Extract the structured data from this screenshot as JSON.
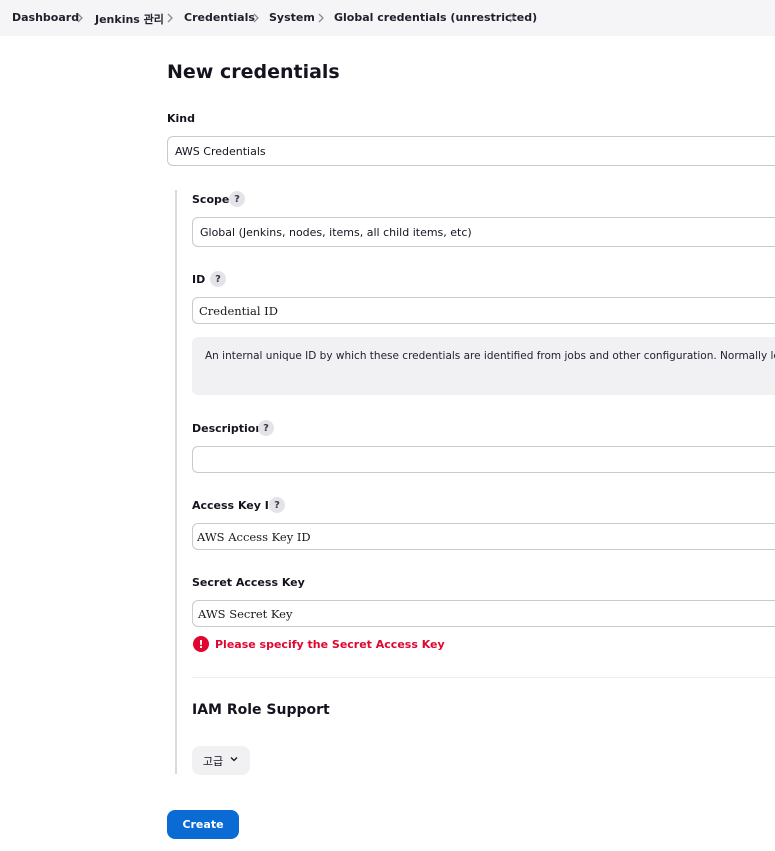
{
  "breadcrumb": {
    "items": [
      "Dashboard",
      "Jenkins 관리",
      "Credentials",
      "System",
      "Global credentials (unrestricted)"
    ],
    "separator_icon": "chevron-right-icon"
  },
  "page": {
    "title": "New credentials"
  },
  "form": {
    "kind": {
      "label": "Kind",
      "value": "AWS Credentials"
    },
    "scope": {
      "label": "Scope",
      "help": "?",
      "value": "Global (Jenkins, nodes, items, all child items, etc)"
    },
    "id": {
      "label": "ID",
      "help": "?",
      "value": "Credential ID",
      "help_text": "An internal unique ID by which these credentials are identified from jobs and other configuration. Normally left b"
    },
    "description": {
      "label": "Description",
      "help": "?",
      "value": ""
    },
    "access_key_id": {
      "label": "Access Key ID",
      "help": "?",
      "value": "AWS Access Key ID"
    },
    "secret_access_key": {
      "label": "Secret Access Key",
      "value": "AWS Secret Key",
      "error_icon": "!",
      "error": "Please specify the Secret Access Key"
    },
    "iam_section": {
      "title": "IAM Role Support",
      "advanced_label": "고급"
    },
    "submit_label": "Create"
  },
  "colors": {
    "primary": "#0b6bd4",
    "error": "#e0062f",
    "breadcrumb_bg": "#f5f5f7"
  }
}
